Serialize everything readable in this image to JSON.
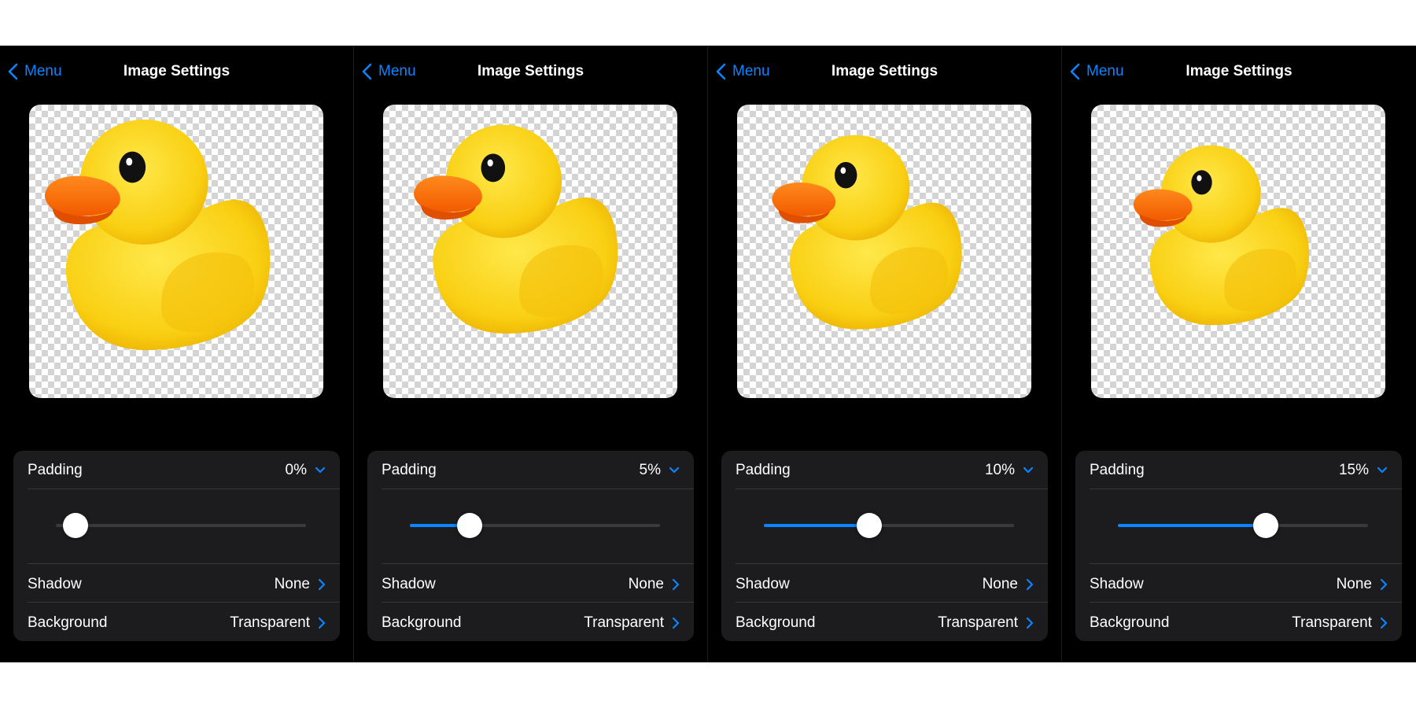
{
  "accent": "#0a84ff",
  "nav": {
    "back_label": "Menu",
    "title": "Image Settings"
  },
  "padding_label": "Padding",
  "shadow_label": "Shadow",
  "shadow_value": "None",
  "background_label": "Background",
  "background_value": "Transparent",
  "panels": [
    {
      "padding_value": "0%",
      "slider_fraction": 0.08
    },
    {
      "padding_value": "5%",
      "slider_fraction": 0.24
    },
    {
      "padding_value": "10%",
      "slider_fraction": 0.42
    },
    {
      "padding_value": "15%",
      "slider_fraction": 0.59
    }
  ]
}
